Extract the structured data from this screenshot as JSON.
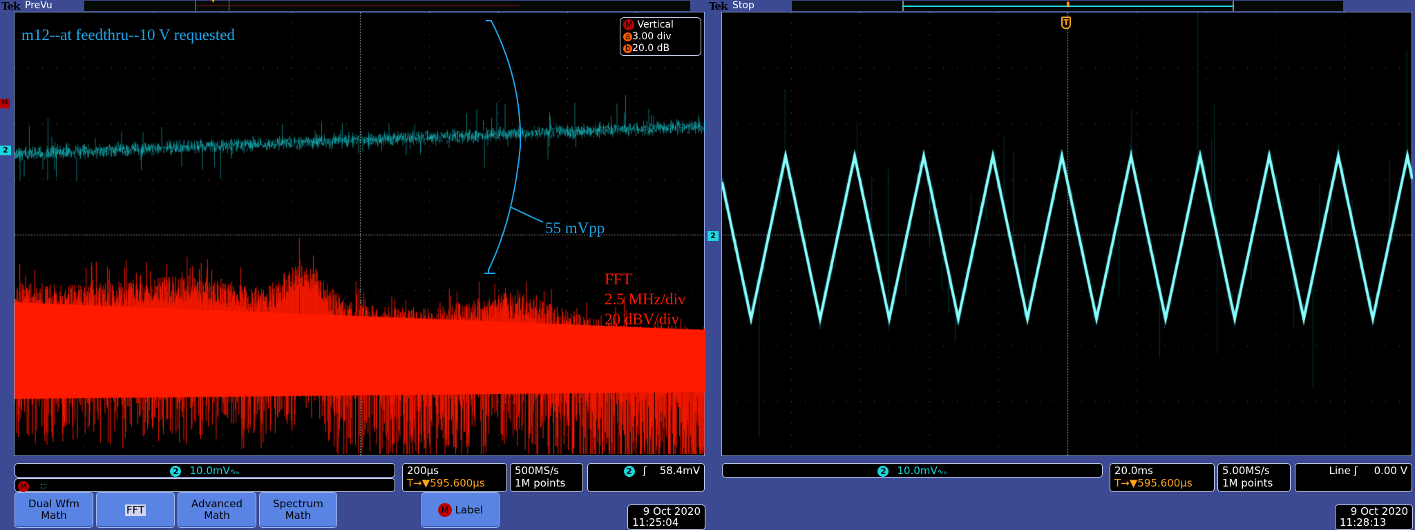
{
  "left": {
    "title_brand": "Tek",
    "state": "PreVu",
    "annotation": "m12--at feedthru--10 V requested",
    "measure_label": "55 mVpp",
    "fft_lines": [
      "FFT",
      "2.5 MHz/div",
      "20 dBV/div"
    ],
    "vertical": {
      "badge": "M",
      "title": "Vertical",
      "a_badge": "a",
      "a_value": "3.00 div",
      "b_badge": "b",
      "b_value": "20.0 dB"
    },
    "markers": {
      "math": "M",
      "ch2": "2"
    },
    "channel_readout": {
      "ch": "2",
      "value": "10.0mV",
      "suffix": "∿ₒ"
    },
    "math_row": {
      "badge": "M"
    },
    "timebase": {
      "scale": "200µs",
      "trigger_pos": "595.600µs",
      "t_marker": "T→▼"
    },
    "acquisition": {
      "rate": "500MS/s",
      "points": "1M points"
    },
    "trigger": {
      "ch": "2",
      "slope": "ʃ",
      "level": "58.4mV"
    },
    "buttons": [
      {
        "label": "Dual Wfm Math"
      },
      {
        "label": "FFT"
      },
      {
        "label": "Advanced Math"
      },
      {
        "label": "Spectrum Math"
      }
    ],
    "label_button": {
      "badge": "M",
      "label": "Label"
    },
    "date": "9 Oct  2020",
    "time": "11:25:04"
  },
  "right": {
    "title_brand": "Tek",
    "state": "Stop",
    "markers": {
      "ch2": "2",
      "trigger": "T"
    },
    "channel_readout": {
      "ch": "2",
      "value": "10.0mV",
      "suffix": "∿ₒ"
    },
    "timebase": {
      "scale": "20.0ms",
      "trigger_pos": "595.600µs",
      "t_marker": "T→▼"
    },
    "acquisition": {
      "rate": "5.00MS/s",
      "points": "1M points"
    },
    "trigger": {
      "source": "Line",
      "slope": "ʃ",
      "level": "0.00 V"
    },
    "date": "9 Oct  2020",
    "time": "11:28:13"
  },
  "colors": {
    "ch2": "#18d8e0",
    "math": "#ff1a00",
    "annotation": "#1ea4e8",
    "trigger": "#ffa21a",
    "background": "#3c4a94"
  }
}
